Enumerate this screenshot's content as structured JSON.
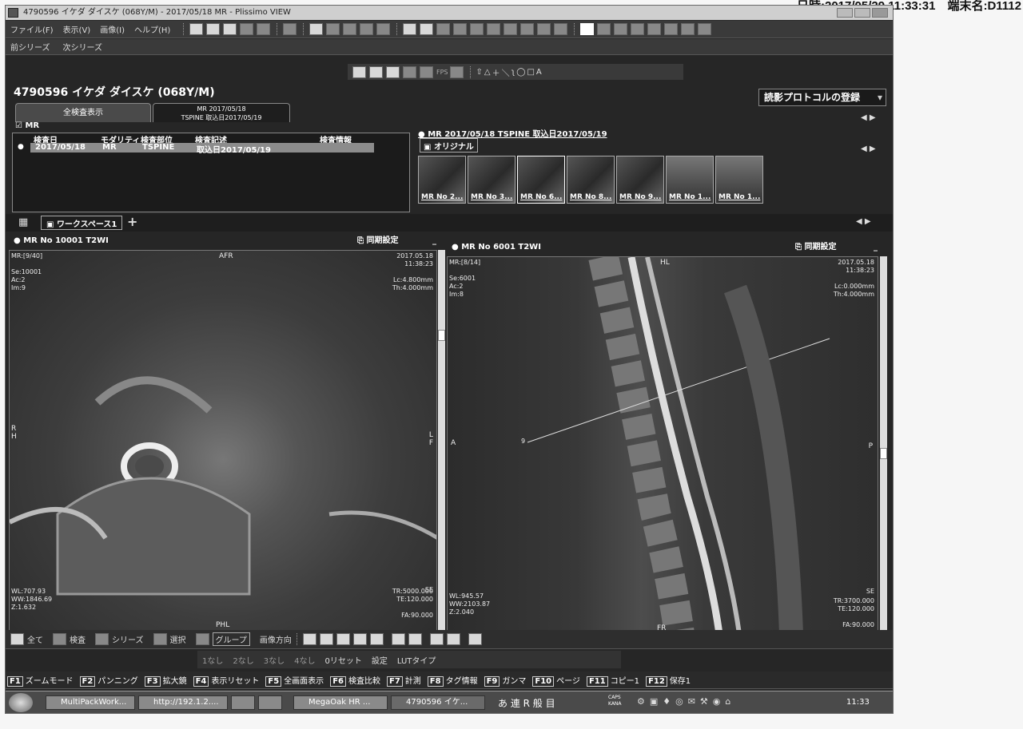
{
  "header_stamp": "日時:2017/05/29 11:33:31　端末名:D1112",
  "window": {
    "title": "4790596 イケダ ダイスケ (068Y/M) - 2017/05/18 MR - Plissimo VIEW"
  },
  "menu": [
    "ファイル(F)",
    "表示(V)",
    "画像(I)",
    "ヘルプ(H)"
  ],
  "series_nav": {
    "prev": "前シリーズ",
    "next": "次シリーズ"
  },
  "fps_label": "FPS",
  "patient": {
    "name": "4790596 イケダ ダイスケ (068Y/M)"
  },
  "protocol_button": "読影プロトコルの登録",
  "tabs": {
    "all_label": "全検査表示",
    "exam_line1": "MR 2017/05/18",
    "exam_line2": "TSPINE 取込日2017/05/19"
  },
  "study_list": {
    "modality_group": "MR",
    "headers": [
      "検査日",
      "モダリティ",
      "検査部位",
      "検査記述",
      "検査情報"
    ],
    "rows": [
      [
        "2017/05/18",
        "MR",
        "TSPINE",
        "取込日2017/05/19",
        ""
      ]
    ]
  },
  "series_panel": {
    "title": "MR 2017/05/18 TSPINE 取込日2017/05/19",
    "original_label": "オリジナル",
    "thumbs": [
      "MR No 2...",
      "MR No 3...",
      "MR No 6...",
      "MR No 8...",
      "MR No 9...",
      "MR No 1...",
      "MR No 1..."
    ]
  },
  "workspace": {
    "label": "ワークスペース1"
  },
  "viewer_left": {
    "title": "MR No 10001 T2WI",
    "sync": "同期設定",
    "top_left": "MR:[9/40]\n\nSe:10001\nAc:2\nIm:9",
    "top_right": "2017.05.18\n11:38:23\n\nLc:4.800mm\nTh:4.000mm",
    "bottom_left": "WL:707.93\nWW:1846.69\nZ:1.632",
    "bottom_right": "TR:5000.000\nTE:120.000\n\nFA:90.000",
    "dir_top": "AFR",
    "dir_bottom": "PHL",
    "dir_left": "R\nH",
    "dir_right": "L\nF",
    "se": "SE"
  },
  "viewer_right": {
    "title": "MR No 6001 T2WI",
    "sync": "同期設定",
    "top_left": "MR:[8/14]\n\nSe:6001\nAc:2\nIm:8",
    "top_right": "2017.05.18\n11:38:23\n\nLc:0.000mm\nTh:4.000mm",
    "bottom_left": "WL:945.57\nWW:2103.87\nZ:2.040",
    "bottom_right": "TR:3700.000\nTE:120.000\n\nFA:90.000",
    "dir_top": "HL",
    "dir_bottom": "FR",
    "dir_left": "A",
    "dir_right": "P",
    "se": "SE",
    "line_label": "9"
  },
  "group_bar": [
    "全て",
    "検査",
    "シリーズ",
    "選択",
    "グループ",
    "画像方向"
  ],
  "preset_bar": [
    "1なし",
    "2なし",
    "3なし",
    "4なし",
    "0リセット",
    "設定",
    "LUTタイプ"
  ],
  "fkeys": [
    {
      "k": "F1",
      "l": "ズームモード"
    },
    {
      "k": "F2",
      "l": "パンニング"
    },
    {
      "k": "F3",
      "l": "拡大鏡"
    },
    {
      "k": "F4",
      "l": "表示リセット"
    },
    {
      "k": "F5",
      "l": "全画面表示"
    },
    {
      "k": "F6",
      "l": "検査比較"
    },
    {
      "k": "F7",
      "l": "計測"
    },
    {
      "k": "F8",
      "l": "タグ情報"
    },
    {
      "k": "F9",
      "l": "ガンマ"
    },
    {
      "k": "F10",
      "l": "ページ"
    },
    {
      "k": "F11",
      "l": "コピー1"
    },
    {
      "k": "F12",
      "l": "保存1"
    }
  ],
  "taskbar": {
    "items": [
      "MultiPackWork...",
      "http://192.1.2....",
      "",
      "",
      "MegaOak HR ...",
      "4790596 イケ..."
    ],
    "ime": "あ 連 R 般 目",
    "caps": "CAPS",
    "kana": "KANA",
    "clock": "11:33"
  }
}
